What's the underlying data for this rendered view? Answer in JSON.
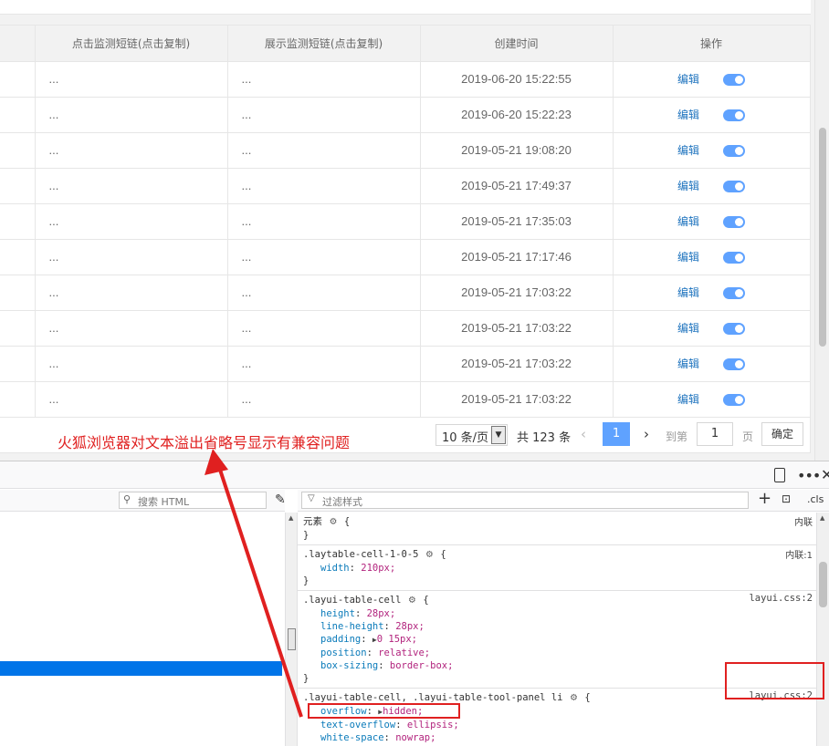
{
  "table": {
    "headers": [
      "",
      "点击监测短链(点击复制)",
      "展示监测短链(点击复制)",
      "创建时间",
      "操作"
    ],
    "rows": [
      {
        "click_link": "...",
        "show_link": "...",
        "created": "2019-06-20 15:22:55",
        "edit": "编辑"
      },
      {
        "click_link": "...",
        "show_link": "...",
        "created": "2019-06-20 15:22:23",
        "edit": "编辑"
      },
      {
        "click_link": "...",
        "show_link": "...",
        "created": "2019-05-21 19:08:20",
        "edit": "编辑"
      },
      {
        "click_link": "...",
        "show_link": "...",
        "created": "2019-05-21 17:49:37",
        "edit": "编辑"
      },
      {
        "click_link": "...",
        "show_link": "...",
        "created": "2019-05-21 17:35:03",
        "edit": "编辑"
      },
      {
        "click_link": "...",
        "show_link": "...",
        "created": "2019-05-21 17:17:46",
        "edit": "编辑"
      },
      {
        "click_link": "...",
        "show_link": "...",
        "created": "2019-05-21 17:03:22",
        "edit": "编辑"
      },
      {
        "click_link": "...",
        "show_link": "...",
        "created": "2019-05-21 17:03:22",
        "edit": "编辑"
      },
      {
        "click_link": "...",
        "show_link": "...",
        "created": "2019-05-21 17:03:22",
        "edit": "编辑"
      },
      {
        "click_link": "...",
        "show_link": "...",
        "created": "2019-05-21 17:03:22",
        "edit": "编辑"
      }
    ],
    "switch_state": "on",
    "switch_color": "#5fa2ff"
  },
  "pager": {
    "page_size": "10 条/页",
    "size_arrow": "▼",
    "total": "共 123 条",
    "prev": "‹",
    "current_page": "1",
    "next": "›",
    "goto_label": "到第",
    "goto_value": "1",
    "page_unit": "页",
    "confirm": "确定"
  },
  "annotation": {
    "text": "火狐浏览器对文本溢出省略号显示有兼容问题",
    "color": "#e02020"
  },
  "devtools": {
    "toolbar": {
      "more": "•••",
      "close": "✕",
      "search_html_placeholder": "搜索 HTML",
      "filter_styles_placeholder": "过滤样式",
      "add_rule": "+",
      "cls": ".cls"
    },
    "rules": [
      {
        "selector": "元素",
        "brace": "{",
        "source": "内联",
        "declarations": []
      },
      {
        "selector": ".laytable-cell-1-0-5",
        "brace": "{",
        "source": "内联:1",
        "declarations": [
          {
            "prop": "width",
            "value": "210px;"
          }
        ]
      },
      {
        "selector": ".layui-table-cell",
        "brace": "{",
        "source": "layui.css:2",
        "declarations": [
          {
            "prop": "height",
            "value": "28px;"
          },
          {
            "prop": "line-height",
            "value": "28px;"
          },
          {
            "prop": "padding",
            "value": "0 15px;"
          },
          {
            "prop": "position",
            "value": "relative;"
          },
          {
            "prop": "box-sizing",
            "value": "border-box;"
          }
        ]
      },
      {
        "selector": ".layui-table-cell, .layui-table-tool-panel li",
        "brace": "{",
        "source": "layui.css:2",
        "declarations": [
          {
            "prop": "overflow",
            "value": "hidden;"
          },
          {
            "prop": "text-overflow",
            "value": "ellipsis;"
          },
          {
            "prop": "white-space",
            "value": "nowrap;"
          }
        ]
      }
    ],
    "close_brace": "}",
    "selected_node_color": "#0074e8"
  }
}
